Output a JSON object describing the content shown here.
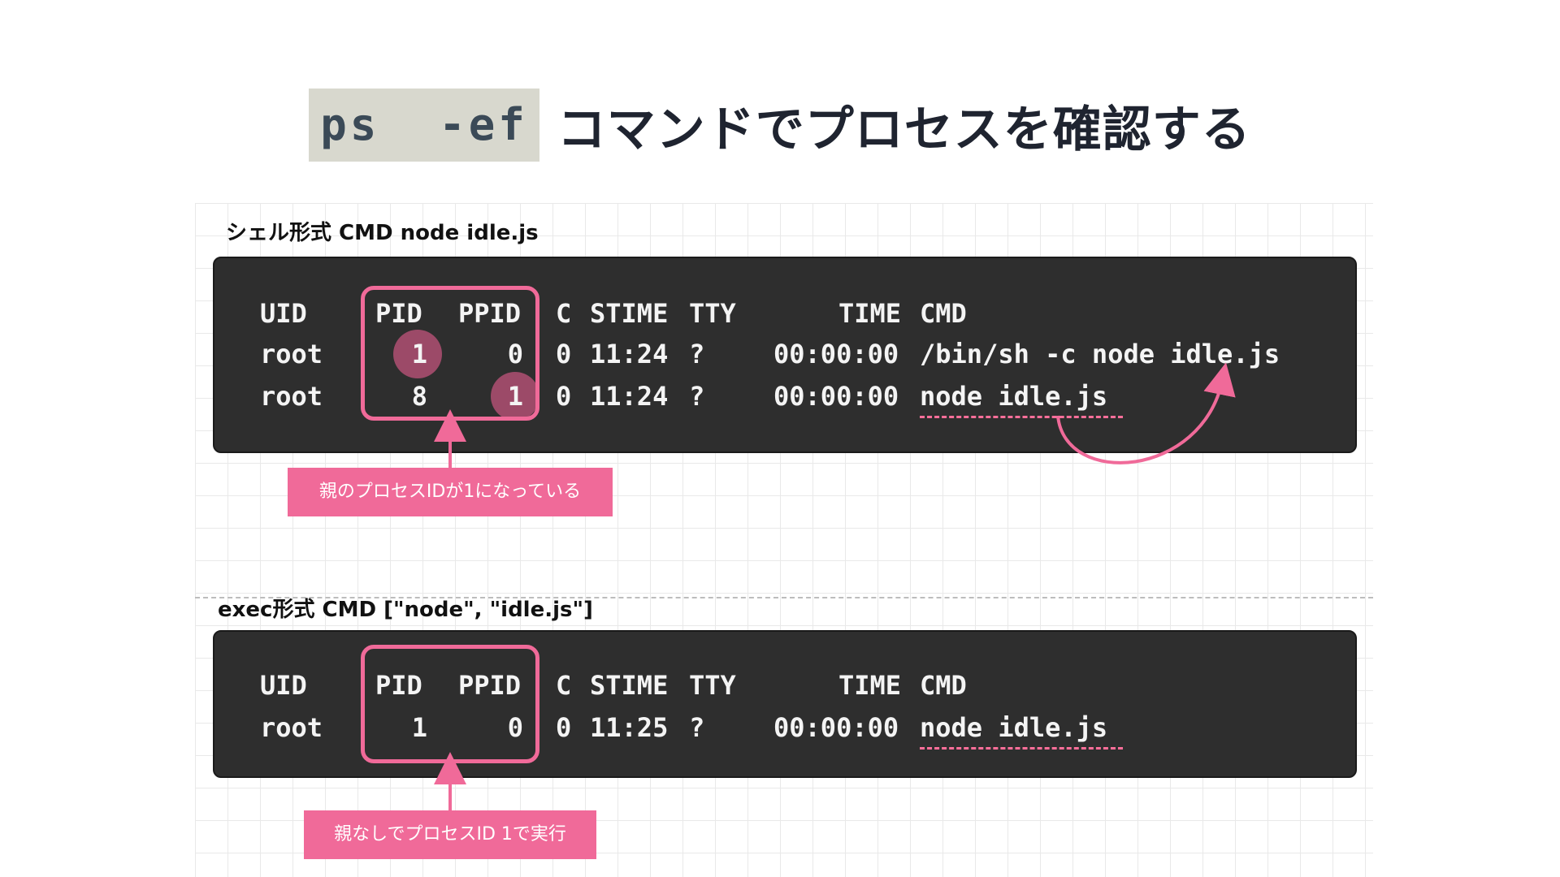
{
  "title": {
    "command": "ps  -ef",
    "text": "コマンドでプロセスを確認する"
  },
  "shell_section": {
    "label": "シェル形式 CMD node idle.js",
    "header": {
      "uid": "UID",
      "pid": "PID",
      "ppid": "PPID",
      "c": "C",
      "stime": "STIME",
      "tty": "TTY",
      "time": "TIME",
      "cmd": "CMD"
    },
    "rows": [
      {
        "uid": "root",
        "pid": "1",
        "ppid": "0",
        "c": "0",
        "stime": "11:24",
        "tty": "?",
        "time": "00:00:00",
        "cmd": "/bin/sh -c node idle.js"
      },
      {
        "uid": "root",
        "pid": "8",
        "ppid": "1",
        "c": "0",
        "stime": "11:24",
        "tty": "?",
        "time": "00:00:00",
        "cmd": "node idle.js"
      }
    ],
    "callout": "親のプロセスIDが1になっている"
  },
  "exec_section": {
    "label": "exec形式 CMD [\"node\", \"idle.js\"]",
    "header": {
      "uid": "UID",
      "pid": "PID",
      "ppid": "PPID",
      "c": "C",
      "stime": "STIME",
      "tty": "TTY",
      "time": "TIME",
      "cmd": "CMD"
    },
    "rows": [
      {
        "uid": "root",
        "pid": "1",
        "ppid": "0",
        "c": "0",
        "stime": "11:25",
        "tty": "?",
        "time": "00:00:00",
        "cmd": "node idle.js"
      }
    ],
    "callout": "親なしでプロセスID 1で実行"
  },
  "colors": {
    "accent": "#f06a99",
    "terminal_bg": "#2e2e2e",
    "highlight": "#9c4a68",
    "chip_bg": "#d8d8ce"
  }
}
